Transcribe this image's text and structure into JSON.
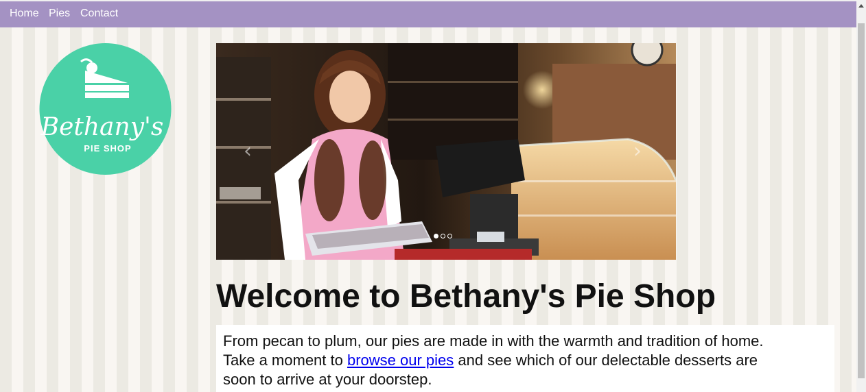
{
  "nav": {
    "items": [
      {
        "label": "Home"
      },
      {
        "label": "Pies"
      },
      {
        "label": "Contact"
      }
    ]
  },
  "logo": {
    "name": "Bethany's",
    "tagline": "Pie Shop",
    "color": "#4ad1a7",
    "icon": "cake-slice-icon"
  },
  "carousel": {
    "prev_icon": "chevron-left-icon",
    "next_icon": "chevron-right-icon",
    "slide_count": 3,
    "active_slide": 1
  },
  "main": {
    "title": "Welcome to Bethany's Pie Shop",
    "intro_line1": "From pecan to plum, our pies are made in with the warmth and tradition of home.",
    "intro_before_link": "Take a moment to ",
    "intro_link": "browse our pies",
    "intro_after_link": " and see which of our delectable desserts are",
    "intro_line3": "soon to arrive at your doorstep."
  },
  "colors": {
    "nav_bg": "#a492c3",
    "logo_bg": "#4ad1a7",
    "link": "#0000ee"
  }
}
